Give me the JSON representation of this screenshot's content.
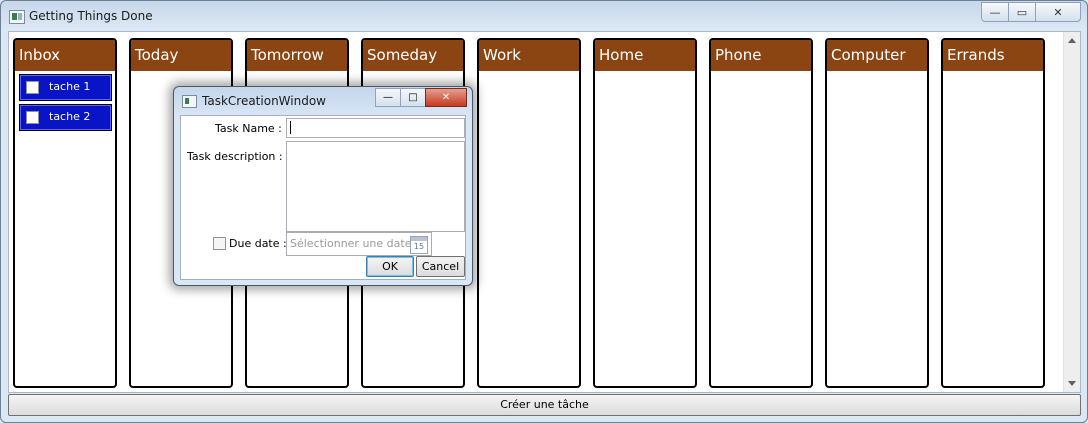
{
  "window": {
    "title": "Getting Things Done"
  },
  "columns": [
    {
      "name": "Inbox",
      "tasks": [
        {
          "label": "tache 1"
        },
        {
          "label": "tache 2"
        }
      ]
    },
    {
      "name": "Today",
      "tasks": []
    },
    {
      "name": "Tomorrow",
      "tasks": []
    },
    {
      "name": "Someday",
      "tasks": []
    },
    {
      "name": "Work",
      "tasks": []
    },
    {
      "name": "Home",
      "tasks": []
    },
    {
      "name": "Phone",
      "tasks": []
    },
    {
      "name": "Computer",
      "tasks": []
    },
    {
      "name": "Errands",
      "tasks": []
    }
  ],
  "footer": {
    "create_label": "Créer une tâche"
  },
  "dialog": {
    "title": "TaskCreationWindow",
    "task_name_label": "Task Name :",
    "task_name_value": "",
    "task_description_label": "Task description :",
    "due_date_label": "Due date :",
    "due_date_checked": false,
    "date_placeholder": "Sélectionner une date",
    "calendar_day": "15",
    "ok_label": "OK",
    "cancel_label": "Cancel"
  },
  "colors": {
    "column_header": "#8b4513",
    "task_background": "#0a14c7"
  }
}
